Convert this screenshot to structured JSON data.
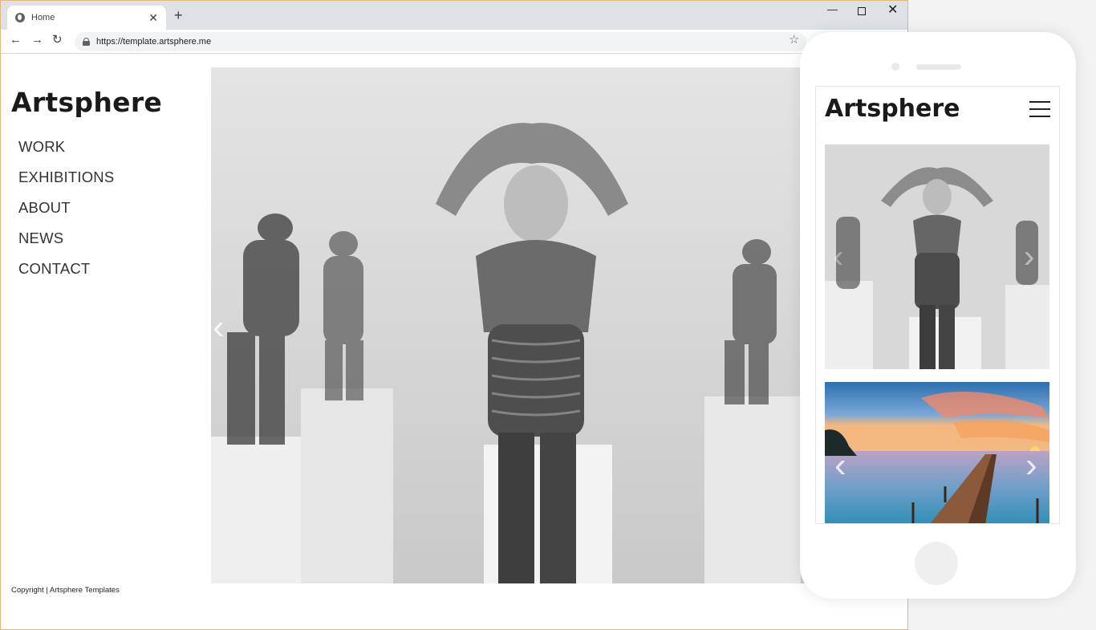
{
  "browser": {
    "tab_title": "Home",
    "tab_icon": "globe-icon",
    "new_tab_symbol": "+",
    "url": "https://template.artsphere.me"
  },
  "site": {
    "logo": "Artsphere",
    "menu": [
      "WORK",
      "EXHIBITIONS",
      "ABOUT",
      "NEWS",
      "CONTACT"
    ],
    "copyright": "Copyright | Artsphere Templates"
  },
  "mobile": {
    "logo": "Artsphere",
    "menu_icon": "hamburger-icon"
  },
  "colors": {
    "text_dark": "#1a1a1a",
    "menu_text": "#333333",
    "browser_chrome": "#dee1e6",
    "window_border": "#e0b77a"
  }
}
